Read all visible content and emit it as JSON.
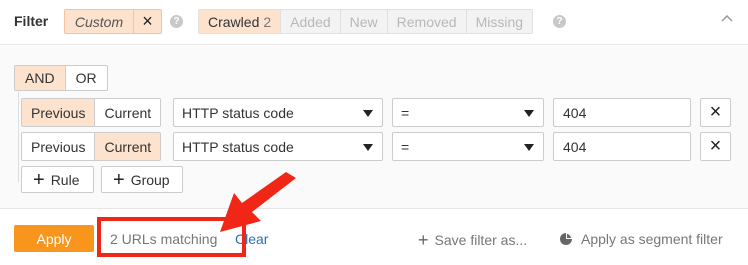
{
  "topbar": {
    "filter_label": "Filter",
    "custom_label": "Custom",
    "custom_close_icon": "×",
    "help_icon": "?",
    "tabs": [
      {
        "label": "Crawled",
        "count": "2"
      },
      {
        "label": "Added"
      },
      {
        "label": "New"
      },
      {
        "label": "Removed"
      },
      {
        "label": "Missing"
      }
    ]
  },
  "logic": {
    "and_label": "AND",
    "or_label": "OR"
  },
  "rules": [
    {
      "previous": "Previous",
      "current": "Current",
      "active": "previous",
      "field": "HTTP status code",
      "operator": "=",
      "value": "404"
    },
    {
      "previous": "Previous",
      "current": "Current",
      "active": "current",
      "field": "HTTP status code",
      "operator": "=",
      "value": "404"
    }
  ],
  "rule_delete_icon": "×",
  "add": {
    "rule_label": "Rule",
    "group_label": "Group",
    "plus_icon": "+"
  },
  "footer": {
    "apply_label": "Apply",
    "matching_text": "2 URLs matching",
    "clear_label": "Clear",
    "save_filter_label": "Save filter as...",
    "segment_label": "Apply as segment filter"
  },
  "colors": {
    "accent": "#f7951d",
    "active_bg": "#fde2cd",
    "callout": "#f02617",
    "link": "#2a6fb7"
  }
}
